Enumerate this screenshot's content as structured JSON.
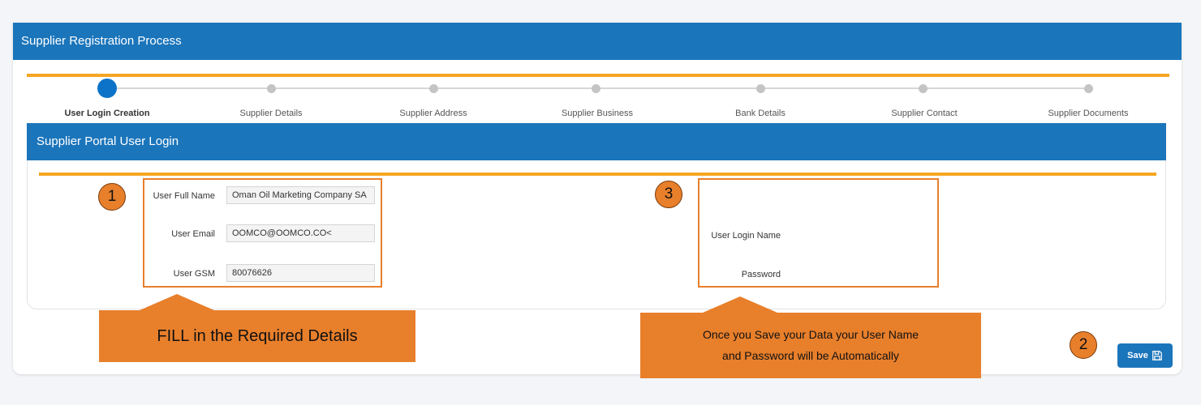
{
  "header": {
    "title": "Supplier Registration Process"
  },
  "steps": [
    {
      "label": "User Login Creation",
      "active": true
    },
    {
      "label": "Supplier Details",
      "active": false
    },
    {
      "label": "Supplier Address",
      "active": false
    },
    {
      "label": "Supplier Business",
      "active": false
    },
    {
      "label": "Bank Details",
      "active": false
    },
    {
      "label": "Supplier Contact",
      "active": false
    },
    {
      "label": "Supplier Documents",
      "active": false
    }
  ],
  "section": {
    "title": "Supplier Portal User Login"
  },
  "form": {
    "full_name_label": "User Full Name",
    "full_name_value": "Oman Oil Marketing Company SA",
    "email_label": "User Email",
    "email_value": "OOMCO@OOMCO.CO<",
    "gsm_label": "User GSM",
    "gsm_value": "80076626",
    "login_name_label": "User Login Name",
    "password_label": "Password"
  },
  "annotations": {
    "badge_1": "1",
    "badge_2": "2",
    "badge_3": "3",
    "callout_fill": "FILL in the Required Details",
    "callout_save_line1": "Once you Save your Data your User Name",
    "callout_save_line2": "and Password will be Automatically"
  },
  "actions": {
    "save_label": "Save",
    "save_icon": "save-icon"
  },
  "colors": {
    "primary": "#1b75bb",
    "accent_line": "#f5a623",
    "annotation": "#e87f2b",
    "active_step": "#0d73c9"
  }
}
